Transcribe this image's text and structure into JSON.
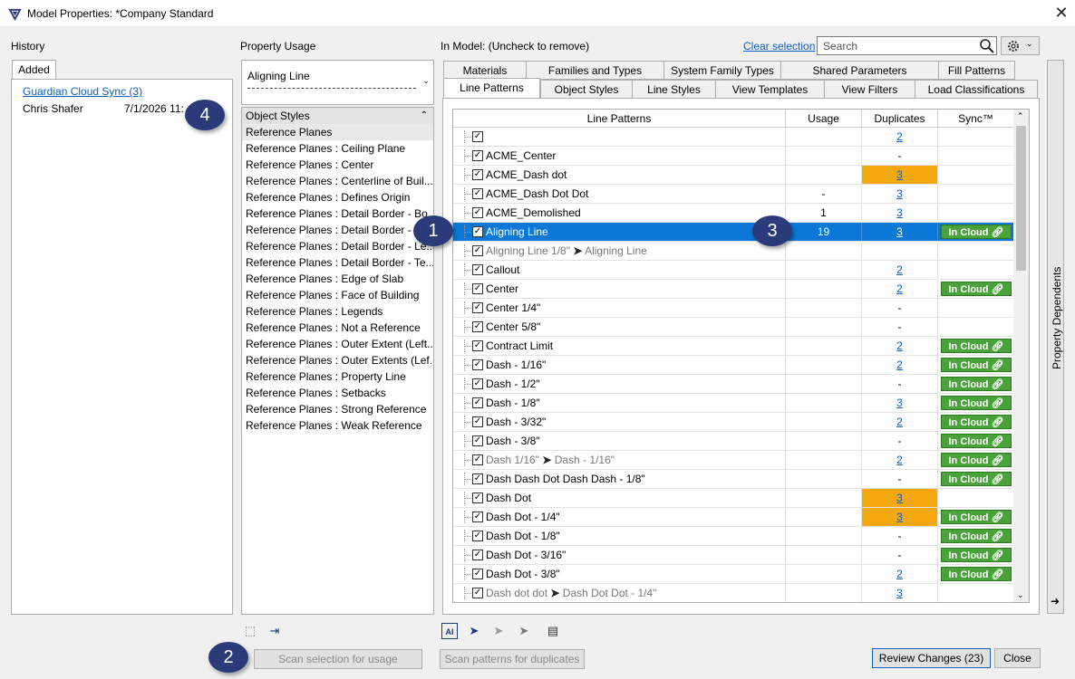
{
  "window": {
    "title": "Model Properties: *Company Standard",
    "close": "✕"
  },
  "history": {
    "label": "History",
    "tab": "Added",
    "entries": [
      {
        "name": "Guardian Cloud Sync (3)"
      },
      {
        "user": "Chris Shafer",
        "date": "7/1/2026 11:"
      }
    ]
  },
  "usage": {
    "label": "Property Usage",
    "selected": "Aligning Line",
    "group": "Object Styles",
    "items": [
      "Reference Planes",
      "Reference Planes : Ceiling Plane",
      "Reference Planes : Center",
      "Reference Planes : Centerline of Buil...",
      "Reference Planes : Defines Origin",
      "Reference Planes : Detail Border - Bo",
      "Reference Planes : Detail Border - C",
      "Reference Planes : Detail Border - Le...",
      "Reference Planes : Detail Border - Te...",
      "Reference Planes : Edge of Slab",
      "Reference Planes : Face of Building",
      "Reference Planes : Legends",
      "Reference Planes : Not a Reference",
      "Reference Planes : Outer Extent (Left...",
      "Reference Planes : Outer Extents (Lef...",
      "Reference Planes : Property Line",
      "Reference Planes : Setbacks",
      "Reference Planes : Strong Reference",
      "Reference Planes : Weak Reference"
    ]
  },
  "model": {
    "label": "In Model: (Uncheck to remove)",
    "clear_selection": "Clear selection",
    "search_placeholder": "Search",
    "tabs_top": [
      "Materials",
      "Families and Types",
      "System Family Types",
      "Shared Parameters",
      "Fill Patterns"
    ],
    "tabs_bottom": [
      "Line Patterns",
      "Object Styles",
      "Line Styles",
      "View Templates",
      "View Filters",
      "Load Classifications"
    ],
    "columns": [
      "Line Patterns",
      "Usage",
      "Duplicates",
      "Sync™"
    ],
    "in_cloud_label": "In Cloud",
    "arrow": "➤",
    "rows": [
      {
        "name": "",
        "usage": "",
        "dup": "2",
        "dupwarn": false,
        "cloud": false
      },
      {
        "name": "ACME_Center",
        "usage": "",
        "dup": "-",
        "dupwarn": false,
        "cloud": false
      },
      {
        "name": "ACME_Dash dot",
        "usage": "",
        "dup": "3",
        "dupwarn": true,
        "cloud": false
      },
      {
        "name": "ACME_Dash Dot Dot",
        "usage": "-",
        "dup": "3",
        "dupwarn": false,
        "cloud": false
      },
      {
        "name": "ACME_Demolished",
        "usage": "1",
        "dup": "3",
        "dupwarn": false,
        "cloud": false
      },
      {
        "name": "Aligning Line",
        "usage": "19",
        "dup": "3",
        "dupwarn": false,
        "cloud": true,
        "selected": true
      },
      {
        "name": "Aligning Line 1/8\"",
        "target": "Aligning Line",
        "usage": "",
        "dup": "",
        "dupwarn": false,
        "cloud": false,
        "grey": true
      },
      {
        "name": "Callout",
        "usage": "",
        "dup": "2",
        "dupwarn": false,
        "cloud": false
      },
      {
        "name": "Center",
        "usage": "",
        "dup": "2",
        "dupwarn": false,
        "cloud": true
      },
      {
        "name": "Center 1/4\"",
        "usage": "",
        "dup": "-",
        "dupwarn": false,
        "cloud": false
      },
      {
        "name": "Center 5/8\"",
        "usage": "",
        "dup": "-",
        "dupwarn": false,
        "cloud": false
      },
      {
        "name": "Contract Limit",
        "usage": "",
        "dup": "2",
        "dupwarn": false,
        "cloud": true
      },
      {
        "name": "Dash - 1/16\"",
        "usage": "",
        "dup": "2",
        "dupwarn": false,
        "cloud": true
      },
      {
        "name": "Dash - 1/2\"",
        "usage": "",
        "dup": "-",
        "dupwarn": false,
        "cloud": true
      },
      {
        "name": "Dash - 1/8\"",
        "usage": "",
        "dup": "3",
        "dupwarn": false,
        "cloud": true
      },
      {
        "name": "Dash - 3/32\"",
        "usage": "",
        "dup": "2",
        "dupwarn": false,
        "cloud": true
      },
      {
        "name": "Dash - 3/8\"",
        "usage": "",
        "dup": "-",
        "dupwarn": false,
        "cloud": true
      },
      {
        "name": "Dash 1/16\"",
        "target": "Dash - 1/16\"",
        "usage": "",
        "dup": "2",
        "dupwarn": false,
        "cloud": true,
        "grey": true
      },
      {
        "name": "Dash Dash Dot Dash Dash - 1/8\"",
        "usage": "",
        "dup": "-",
        "dupwarn": false,
        "cloud": true
      },
      {
        "name": "Dash Dot",
        "usage": "",
        "dup": "3",
        "dupwarn": true,
        "cloud": false
      },
      {
        "name": "Dash Dot - 1/4\"",
        "usage": "",
        "dup": "3",
        "dupwarn": true,
        "cloud": true
      },
      {
        "name": "Dash Dot - 1/8\"",
        "usage": "",
        "dup": "-",
        "dupwarn": false,
        "cloud": true
      },
      {
        "name": "Dash Dot - 3/16\"",
        "usage": "",
        "dup": "-",
        "dupwarn": false,
        "cloud": true
      },
      {
        "name": "Dash Dot - 3/8\"",
        "usage": "",
        "dup": "2",
        "dupwarn": false,
        "cloud": true
      },
      {
        "name": "Dash dot dot",
        "target": "Dash Dot Dot - 1/4\"",
        "usage": "",
        "dup": "3",
        "dupwarn": false,
        "cloud": false,
        "grey": true
      }
    ],
    "side_panel": "Property Dependents"
  },
  "buttons": {
    "scan_selection": "Scan selection for usage",
    "scan_patterns": "Scan patterns for duplicates",
    "review": "Review Changes (23)",
    "close": "Close"
  },
  "callouts": [
    "1",
    "2",
    "3",
    "4"
  ],
  "colors": {
    "accent": "#0b78d7",
    "cloud": "#4aa33a",
    "warn": "#f5a70e",
    "callout": "#2b3a78"
  }
}
